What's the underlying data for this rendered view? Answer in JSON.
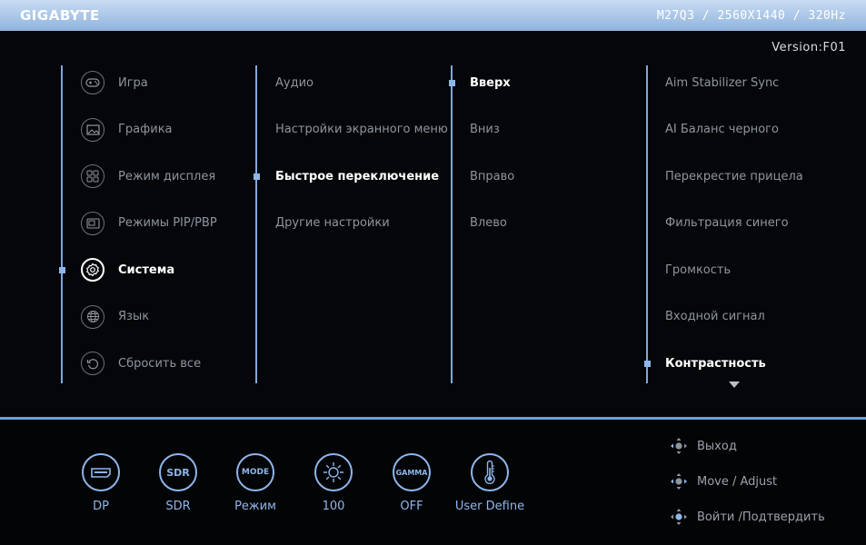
{
  "header": {
    "brand": "GIGABYTE",
    "model": "M27Q3 / 2560X1440 / 320Hz"
  },
  "version": "Version:F01",
  "main_menu": [
    {
      "label": "Игра",
      "icon": "gamepad-icon",
      "selected": false
    },
    {
      "label": "Графика",
      "icon": "picture-icon",
      "selected": false
    },
    {
      "label": "Режим дисплея",
      "icon": "display-mode-icon",
      "selected": false
    },
    {
      "label": "Режимы PIP/PBP",
      "icon": "pip-icon",
      "selected": false
    },
    {
      "label": "Система",
      "icon": "gear-icon",
      "selected": true
    },
    {
      "label": "Язык",
      "icon": "globe-icon",
      "selected": false
    },
    {
      "label": "Сбросить все",
      "icon": "reset-icon",
      "selected": false
    }
  ],
  "sub_menu": [
    {
      "label": "Аудио",
      "selected": false
    },
    {
      "label": "Настройки экранного меню",
      "selected": false
    },
    {
      "label": "Быстрое переключение",
      "selected": true
    },
    {
      "label": "Другие настройки",
      "selected": false
    }
  ],
  "direction_menu": [
    {
      "label": "Вверх",
      "selected": true
    },
    {
      "label": "Вниз",
      "selected": false
    },
    {
      "label": "Вправо",
      "selected": false
    },
    {
      "label": "Влево",
      "selected": false
    }
  ],
  "options_menu": [
    {
      "label": "Aim Stabilizer Sync",
      "selected": false
    },
    {
      "label": "AI Баланс черного",
      "selected": false
    },
    {
      "label": "Перекрестие прицела",
      "selected": false
    },
    {
      "label": "Фильтрация синего",
      "selected": false
    },
    {
      "label": "Громкость",
      "selected": false
    },
    {
      "label": "Входной сигнал",
      "selected": false
    },
    {
      "label": "Контрастность",
      "selected": true
    }
  ],
  "quick_status": [
    {
      "label": "DP",
      "icon": "dp-port-icon",
      "badge": ""
    },
    {
      "label": "SDR",
      "icon": "sdr-icon",
      "badge": "SDR"
    },
    {
      "label": "Режим",
      "icon": "mode-icon",
      "badge": "MODE"
    },
    {
      "label": "100",
      "icon": "brightness-icon",
      "badge": ""
    },
    {
      "label": "OFF",
      "icon": "gamma-icon",
      "badge": "GAMMA"
    },
    {
      "label": "User Define",
      "icon": "thermometer-icon",
      "badge": ""
    }
  ],
  "help": [
    {
      "label": "Выход",
      "icon": "joystick-left-icon"
    },
    {
      "label": "Move / Adjust",
      "icon": "joystick-move-icon"
    },
    {
      "label": "Войти /Подтвердить",
      "icon": "joystick-press-icon"
    }
  ],
  "colors": {
    "accent": "#8fb6ea",
    "header": "#a9c6e8",
    "background": "#040609"
  }
}
